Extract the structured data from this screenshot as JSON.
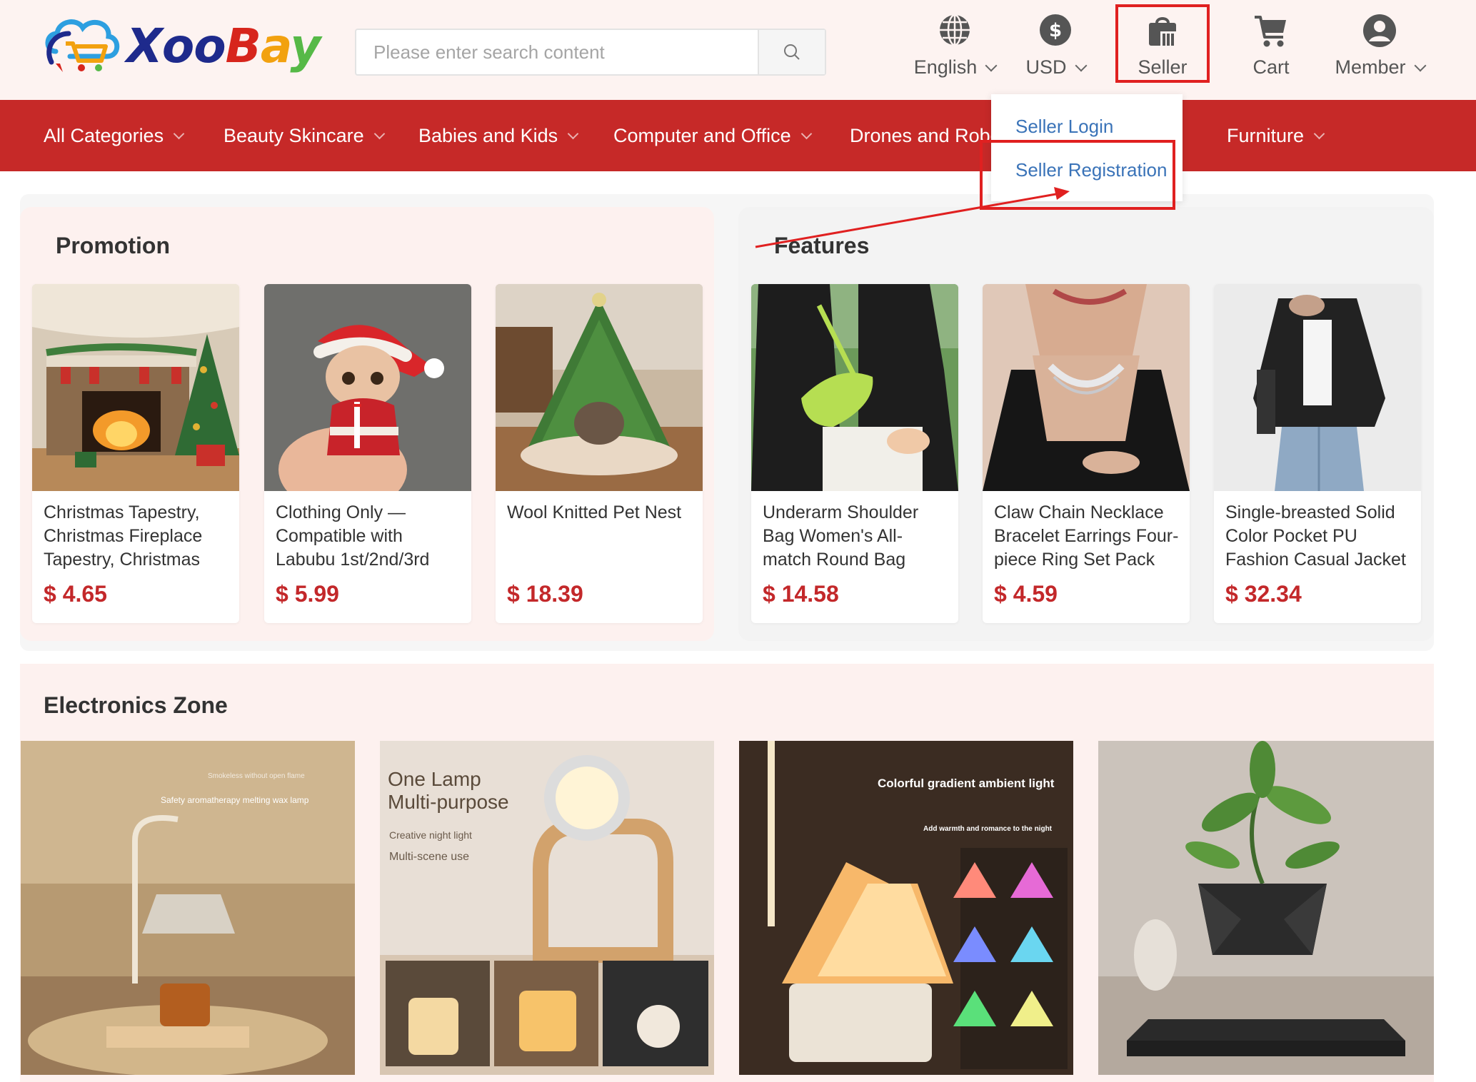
{
  "header": {
    "logo_text": {
      "xoo": "Xoo",
      "b": "B",
      "a": "a",
      "y": "y"
    },
    "search_placeholder": "Please enter search content",
    "language_label": "English",
    "currency_label": "USD",
    "seller_label": "Seller",
    "cart_label": "Cart",
    "member_label": "Member"
  },
  "nav": {
    "items": [
      {
        "label": "All Categories"
      },
      {
        "label": "Beauty Skincare"
      },
      {
        "label": "Babies and Kids"
      },
      {
        "label": "Computer and Office"
      },
      {
        "label": "Drones and Robot"
      },
      {
        "label": "Furniture"
      }
    ]
  },
  "seller_dropdown": {
    "items": [
      {
        "label": "Seller Login"
      },
      {
        "label": "Seller Registration"
      }
    ]
  },
  "promotion": {
    "title": "Promotion",
    "products": [
      {
        "name": "Christmas Tapestry, Christmas Fireplace Tapestry, Christmas",
        "price": "$ 4.65"
      },
      {
        "name": "Clothing Only — Compatible with Labubu 1st/2nd/3rd",
        "price": "$ 5.99"
      },
      {
        "name": "Wool Knitted Pet Nest",
        "price": "$ 18.39"
      }
    ]
  },
  "features": {
    "title": "Features",
    "products": [
      {
        "name": "Underarm Shoulder Bag Women's All-match Round Bag",
        "price": "$ 14.58"
      },
      {
        "name": "Claw Chain Necklace Bracelet Earrings Four-piece Ring Set Pack",
        "price": "$ 4.59"
      },
      {
        "name": "Single-breasted Solid Color Pocket PU Fashion Casual Jacket",
        "price": "$ 32.34"
      }
    ]
  },
  "electronics": {
    "title": "Electronics Zone",
    "images": [
      {
        "caption1": "Smokeless without open flame",
        "caption2": "Safety aromatherapy melting wax lamp"
      },
      {
        "caption1": "One Lamp",
        "caption2": "Multi-purpose",
        "caption3": "Creative night light",
        "caption4": "Multi-scene use"
      },
      {
        "caption1": "Colorful gradient ambient light",
        "caption2": "Add warmth and romance to the night"
      },
      {
        "caption1": ""
      }
    ]
  },
  "colors": {
    "brand_red": "#c62928",
    "price_red": "#c3282a",
    "link_blue": "#3a73b8",
    "highlight_red": "#e02020"
  }
}
